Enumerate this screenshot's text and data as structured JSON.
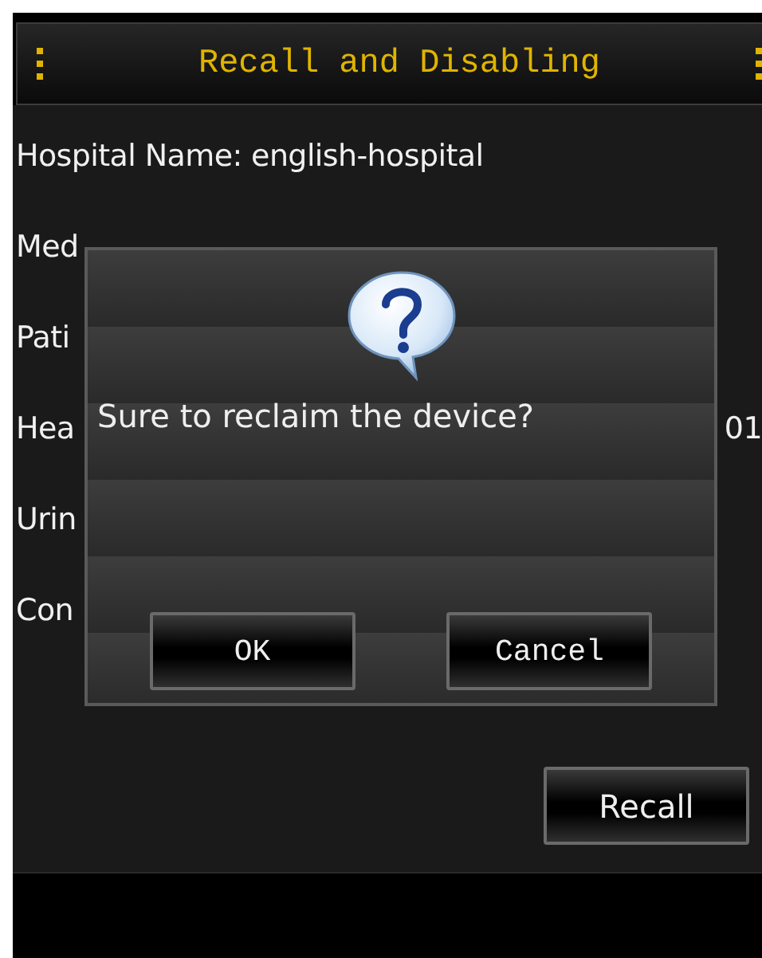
{
  "header": {
    "title": "Recall and Disabling"
  },
  "fields": [
    {
      "label": "Hospital Name: english-hospital"
    },
    {
      "label": "Med"
    },
    {
      "label": "Pati"
    },
    {
      "label": "Hea",
      "value": "01"
    },
    {
      "label": "Urin"
    },
    {
      "label": "Con"
    }
  ],
  "actions": [
    "Recall"
  ],
  "dialog": {
    "message": "Sure to reclaim the device?",
    "buttons": [
      "OK",
      "Cancel"
    ]
  }
}
